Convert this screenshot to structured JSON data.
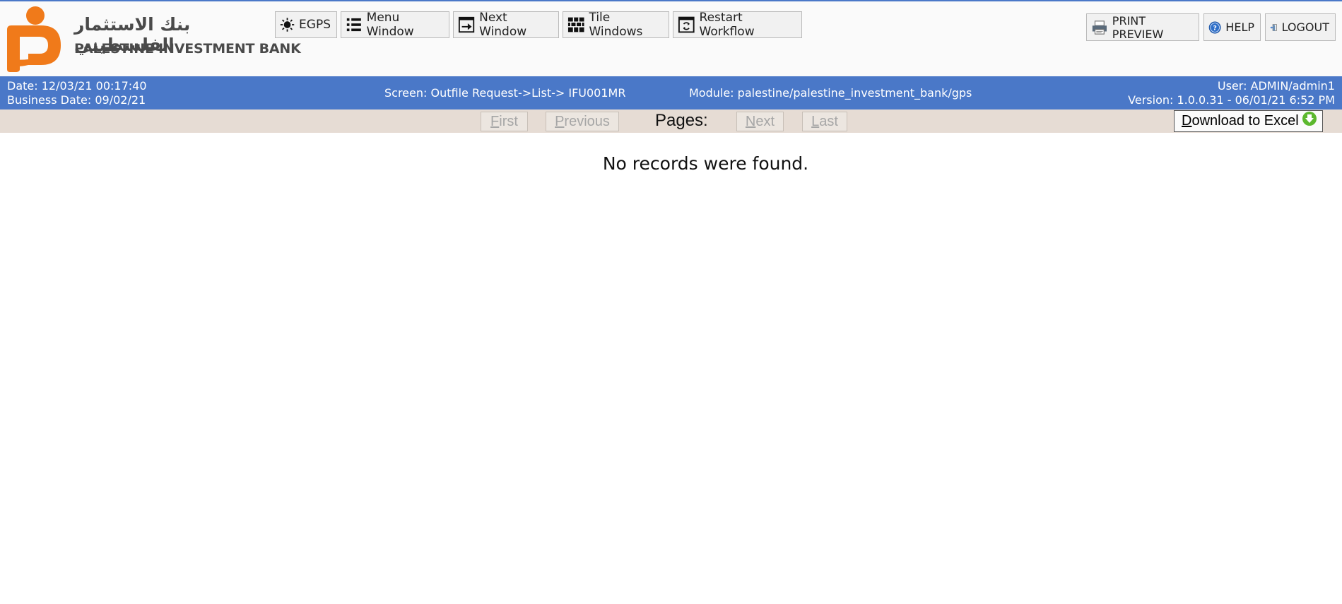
{
  "brand": {
    "name_ar": "بنك الاستثمار الفلسطيني",
    "name_en": "PALESTINE INVESTMENT BANK",
    "logo_color": "#f07a1a"
  },
  "toolbar": {
    "egps": "EGPS",
    "menu_window": "Menu Window",
    "next_window": "Next Window",
    "tile_windows": "Tile Windows",
    "restart_workflow": "Restart Workflow",
    "print_preview": "PRINT PREVIEW",
    "help": "HELP",
    "logout": "LOGOUT"
  },
  "info": {
    "date": "Date: 12/03/21 00:17:40",
    "business_date": "Business Date: 09/02/21",
    "screen": "Screen: Outfile Request->List-> IFU001MR",
    "module": "Module: palestine/palestine_investment_bank/gps",
    "user": "User: ADMIN/admin1",
    "version": "Version: 1.0.0.31 - 06/01/21 6:52 PM"
  },
  "pager": {
    "first": "First",
    "previous": "Previous",
    "pages_label": "Pages:",
    "next": "Next",
    "last": "Last",
    "download": "Download to Excel"
  },
  "content": {
    "message": "No records were found."
  },
  "colors": {
    "header_bar": "#4a78c8",
    "pager_bar": "#e6dcd4",
    "excel_icon": "#5cb82e"
  }
}
